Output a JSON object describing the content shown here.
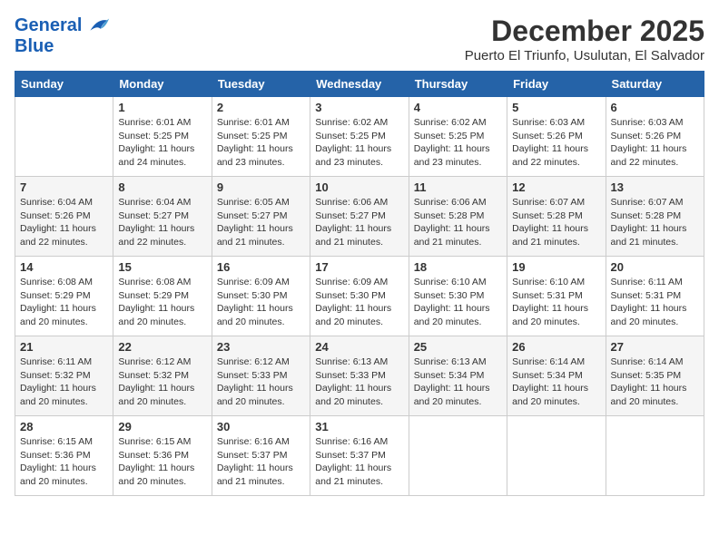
{
  "header": {
    "logo_line1": "General",
    "logo_line2": "Blue",
    "month": "December 2025",
    "location": "Puerto El Triunfo, Usulutan, El Salvador"
  },
  "days_of_week": [
    "Sunday",
    "Monday",
    "Tuesday",
    "Wednesday",
    "Thursday",
    "Friday",
    "Saturday"
  ],
  "weeks": [
    [
      {
        "day": "",
        "content": ""
      },
      {
        "day": "1",
        "content": "Sunrise: 6:01 AM\nSunset: 5:25 PM\nDaylight: 11 hours\nand 24 minutes."
      },
      {
        "day": "2",
        "content": "Sunrise: 6:01 AM\nSunset: 5:25 PM\nDaylight: 11 hours\nand 23 minutes."
      },
      {
        "day": "3",
        "content": "Sunrise: 6:02 AM\nSunset: 5:25 PM\nDaylight: 11 hours\nand 23 minutes."
      },
      {
        "day": "4",
        "content": "Sunrise: 6:02 AM\nSunset: 5:25 PM\nDaylight: 11 hours\nand 23 minutes."
      },
      {
        "day": "5",
        "content": "Sunrise: 6:03 AM\nSunset: 5:26 PM\nDaylight: 11 hours\nand 22 minutes."
      },
      {
        "day": "6",
        "content": "Sunrise: 6:03 AM\nSunset: 5:26 PM\nDaylight: 11 hours\nand 22 minutes."
      }
    ],
    [
      {
        "day": "7",
        "content": "Sunrise: 6:04 AM\nSunset: 5:26 PM\nDaylight: 11 hours\nand 22 minutes."
      },
      {
        "day": "8",
        "content": "Sunrise: 6:04 AM\nSunset: 5:27 PM\nDaylight: 11 hours\nand 22 minutes."
      },
      {
        "day": "9",
        "content": "Sunrise: 6:05 AM\nSunset: 5:27 PM\nDaylight: 11 hours\nand 21 minutes."
      },
      {
        "day": "10",
        "content": "Sunrise: 6:06 AM\nSunset: 5:27 PM\nDaylight: 11 hours\nand 21 minutes."
      },
      {
        "day": "11",
        "content": "Sunrise: 6:06 AM\nSunset: 5:28 PM\nDaylight: 11 hours\nand 21 minutes."
      },
      {
        "day": "12",
        "content": "Sunrise: 6:07 AM\nSunset: 5:28 PM\nDaylight: 11 hours\nand 21 minutes."
      },
      {
        "day": "13",
        "content": "Sunrise: 6:07 AM\nSunset: 5:28 PM\nDaylight: 11 hours\nand 21 minutes."
      }
    ],
    [
      {
        "day": "14",
        "content": "Sunrise: 6:08 AM\nSunset: 5:29 PM\nDaylight: 11 hours\nand 20 minutes."
      },
      {
        "day": "15",
        "content": "Sunrise: 6:08 AM\nSunset: 5:29 PM\nDaylight: 11 hours\nand 20 minutes."
      },
      {
        "day": "16",
        "content": "Sunrise: 6:09 AM\nSunset: 5:30 PM\nDaylight: 11 hours\nand 20 minutes."
      },
      {
        "day": "17",
        "content": "Sunrise: 6:09 AM\nSunset: 5:30 PM\nDaylight: 11 hours\nand 20 minutes."
      },
      {
        "day": "18",
        "content": "Sunrise: 6:10 AM\nSunset: 5:30 PM\nDaylight: 11 hours\nand 20 minutes."
      },
      {
        "day": "19",
        "content": "Sunrise: 6:10 AM\nSunset: 5:31 PM\nDaylight: 11 hours\nand 20 minutes."
      },
      {
        "day": "20",
        "content": "Sunrise: 6:11 AM\nSunset: 5:31 PM\nDaylight: 11 hours\nand 20 minutes."
      }
    ],
    [
      {
        "day": "21",
        "content": "Sunrise: 6:11 AM\nSunset: 5:32 PM\nDaylight: 11 hours\nand 20 minutes."
      },
      {
        "day": "22",
        "content": "Sunrise: 6:12 AM\nSunset: 5:32 PM\nDaylight: 11 hours\nand 20 minutes."
      },
      {
        "day": "23",
        "content": "Sunrise: 6:12 AM\nSunset: 5:33 PM\nDaylight: 11 hours\nand 20 minutes."
      },
      {
        "day": "24",
        "content": "Sunrise: 6:13 AM\nSunset: 5:33 PM\nDaylight: 11 hours\nand 20 minutes."
      },
      {
        "day": "25",
        "content": "Sunrise: 6:13 AM\nSunset: 5:34 PM\nDaylight: 11 hours\nand 20 minutes."
      },
      {
        "day": "26",
        "content": "Sunrise: 6:14 AM\nSunset: 5:34 PM\nDaylight: 11 hours\nand 20 minutes."
      },
      {
        "day": "27",
        "content": "Sunrise: 6:14 AM\nSunset: 5:35 PM\nDaylight: 11 hours\nand 20 minutes."
      }
    ],
    [
      {
        "day": "28",
        "content": "Sunrise: 6:15 AM\nSunset: 5:36 PM\nDaylight: 11 hours\nand 20 minutes."
      },
      {
        "day": "29",
        "content": "Sunrise: 6:15 AM\nSunset: 5:36 PM\nDaylight: 11 hours\nand 20 minutes."
      },
      {
        "day": "30",
        "content": "Sunrise: 6:16 AM\nSunset: 5:37 PM\nDaylight: 11 hours\nand 21 minutes."
      },
      {
        "day": "31",
        "content": "Sunrise: 6:16 AM\nSunset: 5:37 PM\nDaylight: 11 hours\nand 21 minutes."
      },
      {
        "day": "",
        "content": ""
      },
      {
        "day": "",
        "content": ""
      },
      {
        "day": "",
        "content": ""
      }
    ]
  ]
}
